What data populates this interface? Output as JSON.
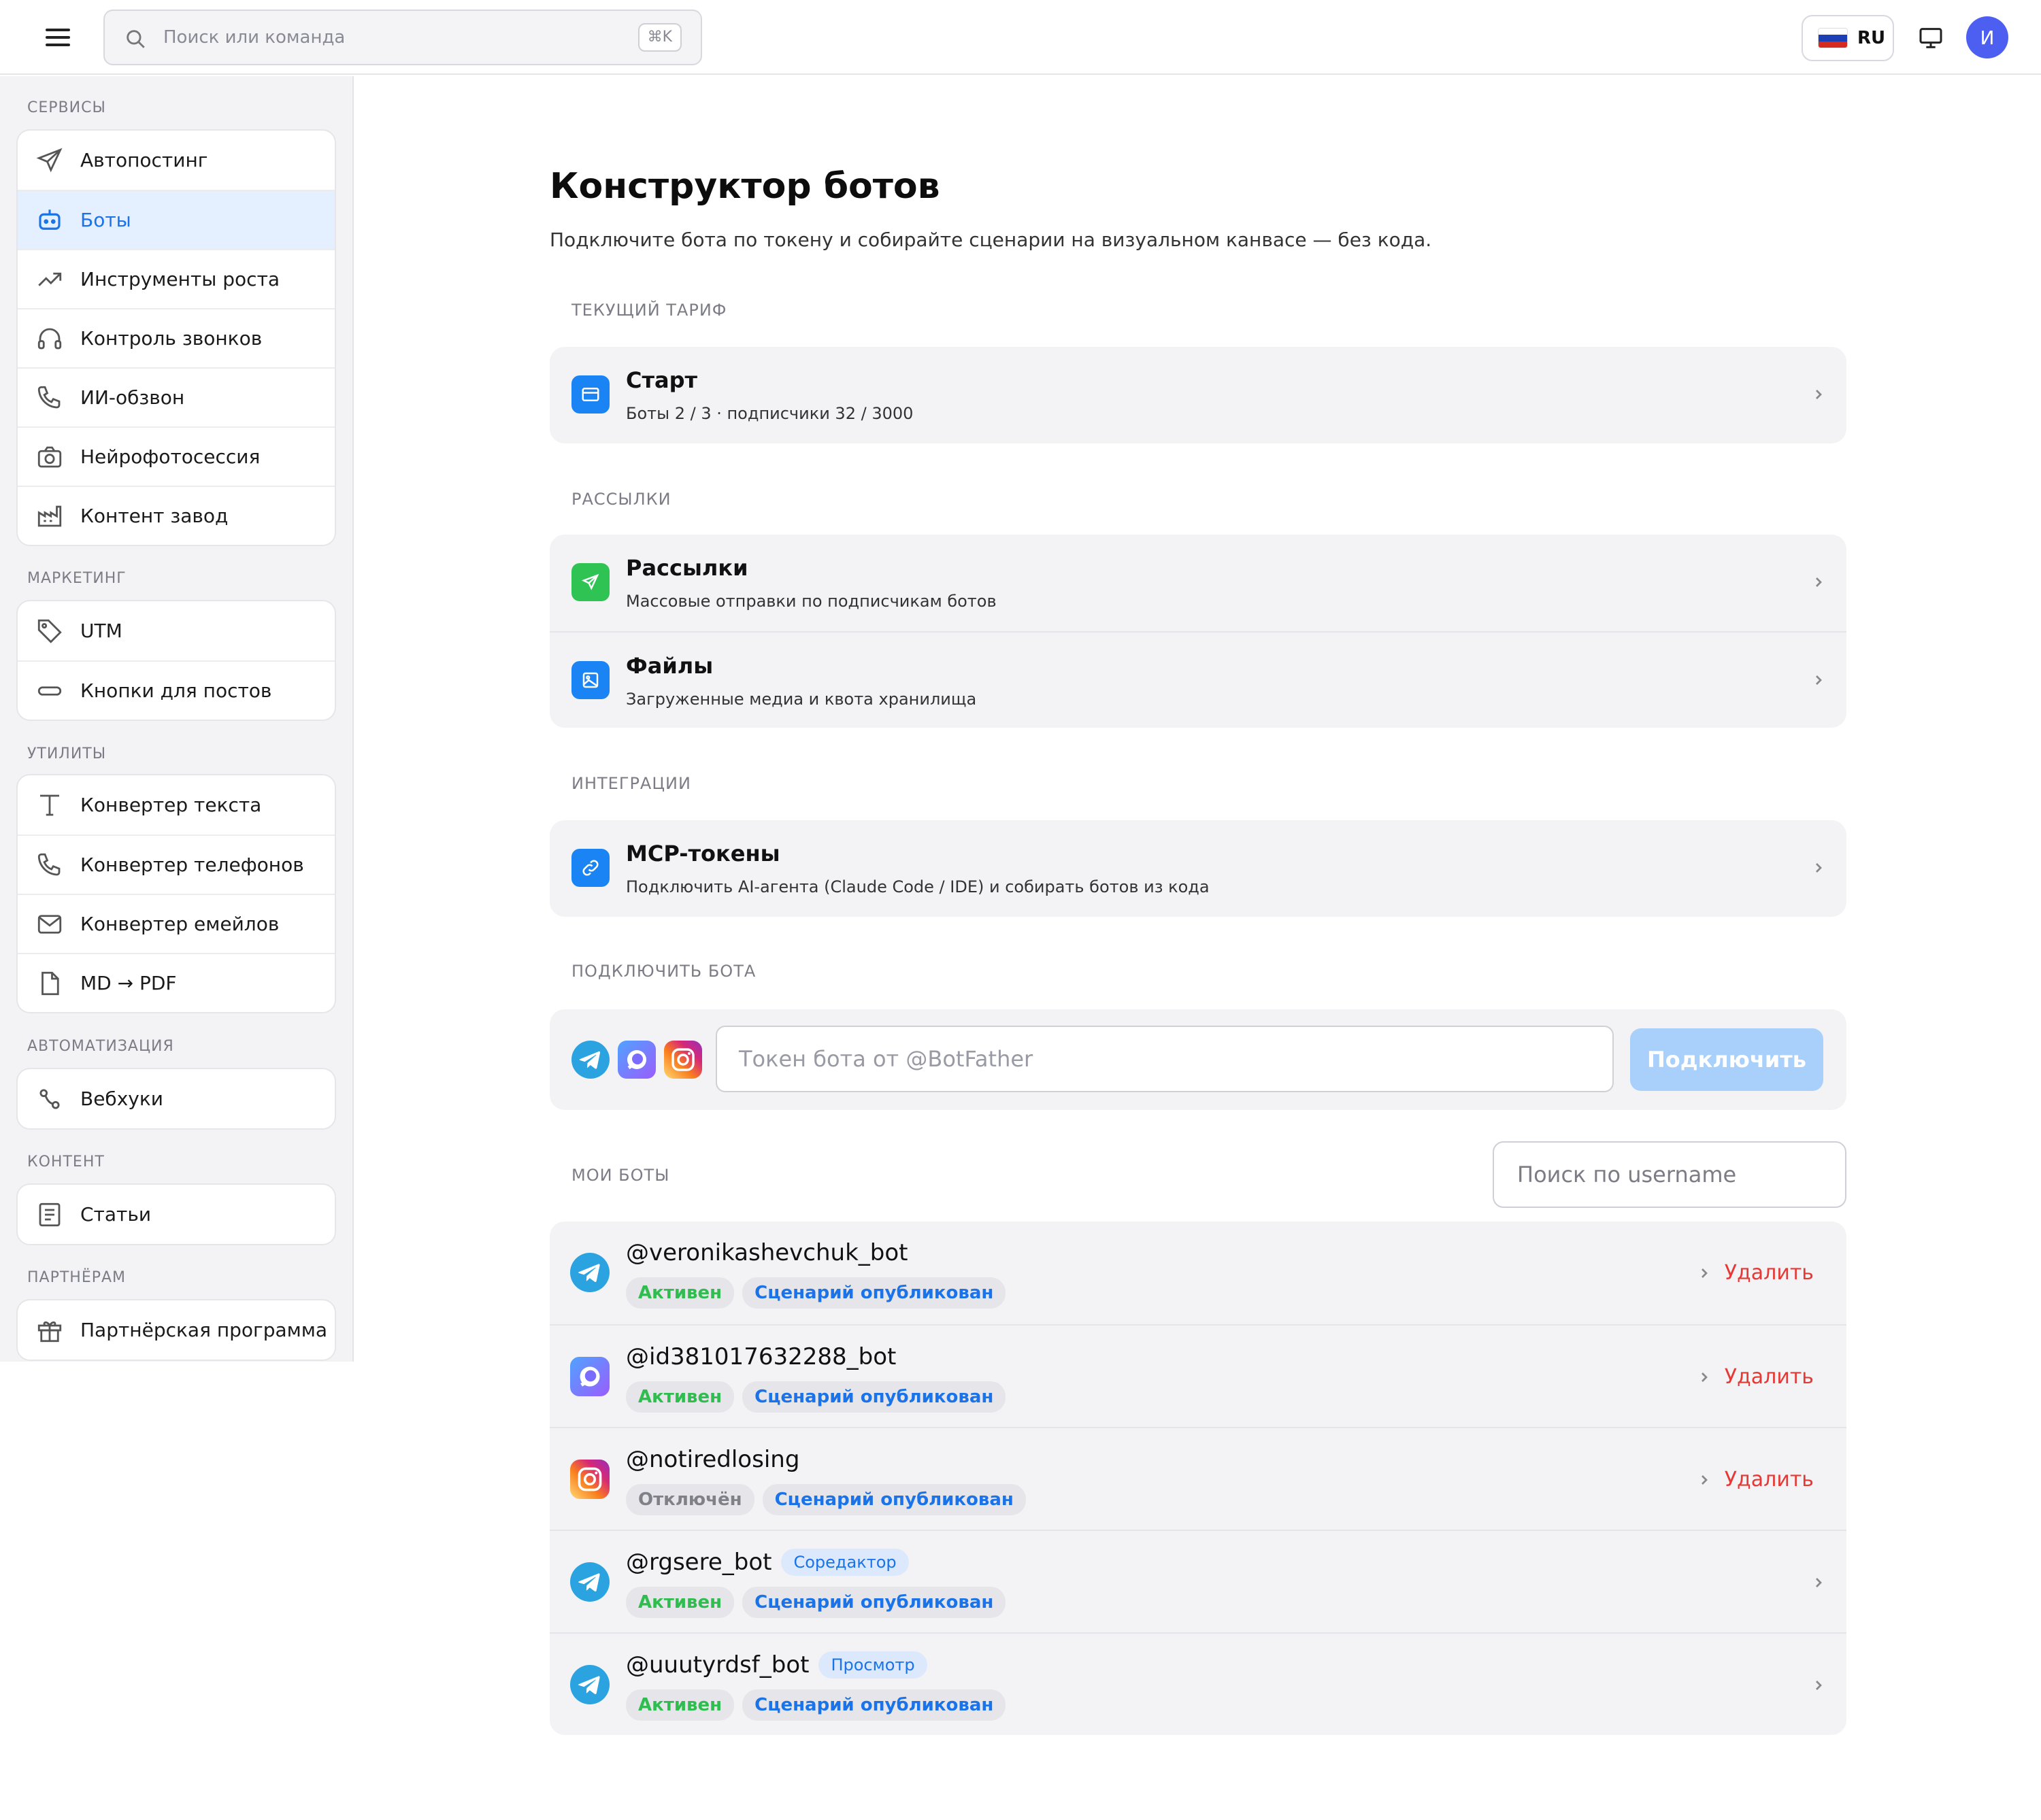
{
  "topbar": {
    "search_placeholder": "Поиск или команда",
    "shortcut": "⌘K",
    "lang_code": "RU",
    "avatar_initial": "И"
  },
  "sidebar": {
    "sections": [
      {
        "title": "СЕРВИСЫ",
        "items": [
          {
            "label": "Автопостинг",
            "icon": "send-icon"
          },
          {
            "label": "Боты",
            "icon": "bot-icon",
            "active": true
          },
          {
            "label": "Инструменты роста",
            "icon": "trending-up-icon"
          },
          {
            "label": "Контроль звонков",
            "icon": "headphones-icon"
          },
          {
            "label": "ИИ-обзвон",
            "icon": "phone-icon"
          },
          {
            "label": "Нейрофотосессия",
            "icon": "camera-icon"
          },
          {
            "label": "Контент завод",
            "icon": "factory-icon"
          }
        ]
      },
      {
        "title": "МАРКЕТИНГ",
        "items": [
          {
            "label": "UTM",
            "icon": "tag-icon"
          },
          {
            "label": "Кнопки для постов",
            "icon": "button-icon"
          }
        ]
      },
      {
        "title": "УТИЛИТЫ",
        "items": [
          {
            "label": "Конвертер текста",
            "icon": "text-icon"
          },
          {
            "label": "Конвертер телефонов",
            "icon": "phone-icon"
          },
          {
            "label": "Конвертер емейлов",
            "icon": "mail-icon"
          },
          {
            "label": "MD → PDF",
            "icon": "file-icon"
          }
        ]
      },
      {
        "title": "АВТОМАТИЗАЦИЯ",
        "items": [
          {
            "label": "Вебхуки",
            "icon": "webhook-icon"
          }
        ]
      },
      {
        "title": "КОНТЕНТ",
        "items": [
          {
            "label": "Статьи",
            "icon": "article-icon"
          }
        ]
      },
      {
        "title": "ПАРТНЁРАМ",
        "items": [
          {
            "label": "Партнёрская программа",
            "icon": "gift-icon"
          }
        ]
      }
    ]
  },
  "main": {
    "title": "Конструктор ботов",
    "subtitle": "Подключите бота по токену и собирайте сценарии на визуальном канвасе — без кода.",
    "tariff": {
      "caption": "ТЕКУЩИЙ ТАРИФ",
      "name": "Старт",
      "details": "Боты 2 / 3 · подписчики 32 / 3000"
    },
    "mailings": {
      "caption": "РАССЫЛКИ",
      "rows": [
        {
          "title": "Рассылки",
          "desc": "Массовые отправки по подписчикам ботов"
        },
        {
          "title": "Файлы",
          "desc": "Загруженные медиа и квота хранилища"
        }
      ]
    },
    "integrations": {
      "caption": "ИНТЕГРАЦИИ",
      "rows": [
        {
          "title": "MCP-токены",
          "desc": "Подключить AI-агента (Claude Code / IDE) и собирать ботов из кода"
        }
      ]
    },
    "connect": {
      "caption": "ПОДКЛЮЧИТЬ БОТА",
      "placeholder": "Токен бота от @BotFather",
      "button": "Подключить"
    },
    "my_bots": {
      "caption": "МОИ БОТЫ",
      "search_placeholder": "Поиск по username",
      "delete_label": "Удалить",
      "bots": [
        {
          "name": "@veronikashevchuk_bot",
          "platform": "telegram",
          "status": "Активен",
          "scenario": "Сценарий опубликован",
          "role": "",
          "deletable": true
        },
        {
          "name": "@id381017632288_bot",
          "platform": "max",
          "status": "Активен",
          "scenario": "Сценарий опубликован",
          "role": "",
          "deletable": true
        },
        {
          "name": "@notiredlosing",
          "platform": "instagram",
          "status": "Отключён",
          "scenario": "Сценарий опубликован",
          "role": "",
          "deletable": true
        },
        {
          "name": "@rgsere_bot",
          "platform": "telegram",
          "status": "Активен",
          "scenario": "Сценарий опубликован",
          "role": "Соредактор",
          "deletable": false
        },
        {
          "name": "@uuutyrdsf_bot",
          "platform": "telegram",
          "status": "Активен",
          "scenario": "Сценарий опубликован",
          "role": "Просмотр",
          "deletable": false
        }
      ]
    }
  },
  "colors": {
    "accent": "#1a73e8",
    "active_bg": "#e4efff",
    "green": "#2fbd4f",
    "danger": "#e53935",
    "card_bg": "#f3f3f6",
    "connect_button": "#a9d0fb"
  }
}
